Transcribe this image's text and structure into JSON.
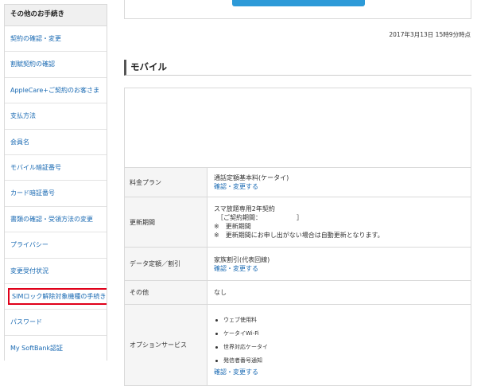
{
  "sidebar": {
    "title": "その他のお手続き",
    "items": [
      {
        "label": "契約の確認・変更"
      },
      {
        "label": "割賦契約の確認"
      },
      {
        "label": "AppleCare+ご契約のお客さま"
      },
      {
        "label": "支払方法"
      },
      {
        "label": "会員名"
      },
      {
        "label": "モバイル暗証番号"
      },
      {
        "label": "カード暗証番号"
      },
      {
        "label": "書類の確認・受領方法の変更"
      },
      {
        "label": "プライバシー"
      },
      {
        "label": "変更受付状況"
      },
      {
        "label": "SIMロック解除対象機種の手続き"
      },
      {
        "label": "パスワード"
      },
      {
        "label": "My SoftBank認証"
      }
    ]
  },
  "timestamp": "2017年3月13日 15時9分時点",
  "section_title": "モバイル",
  "table": {
    "plan": {
      "label": "料金プラン",
      "value": "通話定額基本料(ケータイ)",
      "link": "確認・変更する"
    },
    "renewal": {
      "label": "更新期間",
      "line1": "スマ放題専用2年契約",
      "line2": "［ご契約期間：　　　　　　］",
      "line3": "※　更新期間",
      "line4": "※　更新期間にお申し出がない場合は自動更新となります。"
    },
    "data": {
      "label": "データ定額／割引",
      "value": "家族割引(代表回線)",
      "link": "確認・変更する"
    },
    "other": {
      "label": "その他",
      "value": "なし"
    },
    "options": {
      "label": "オプションサービス",
      "items": [
        "ウェブ使用料",
        "ケータイWi-Fi",
        "世界対応ケータイ",
        "発信者番号通知"
      ],
      "link": "確認・変更する"
    }
  }
}
